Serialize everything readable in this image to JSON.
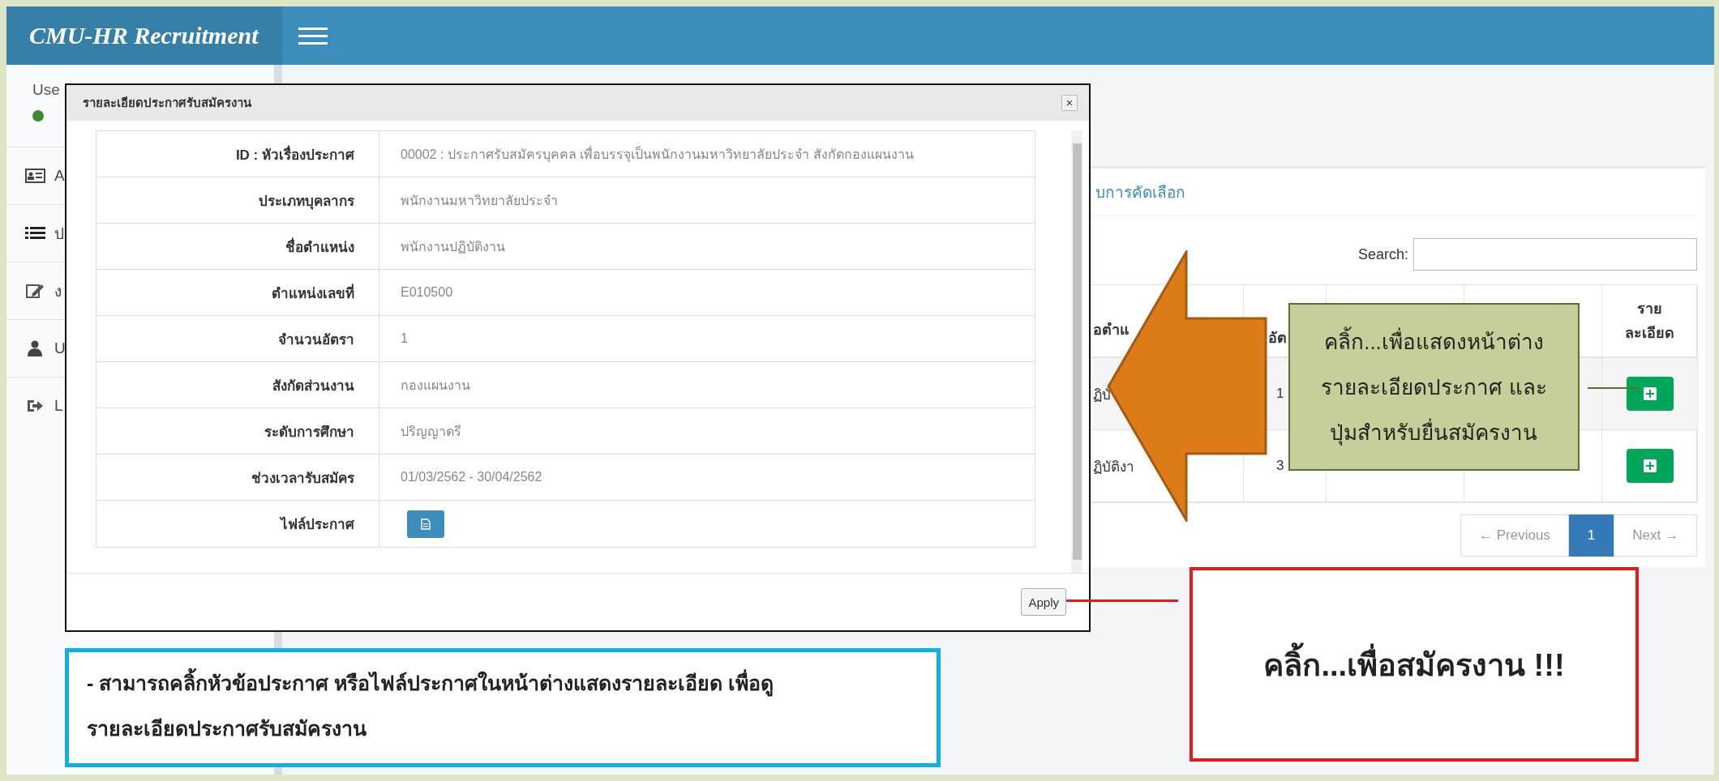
{
  "app": {
    "title": "CMU-HR Recruitment"
  },
  "sidebar": {
    "user_label": "Use",
    "items": [
      {
        "label": "A"
      },
      {
        "label": "ป"
      },
      {
        "label": "ง"
      },
      {
        "label": "U"
      },
      {
        "label": "L"
      }
    ]
  },
  "panel": {
    "heading": "บการคัดเลือก",
    "search_label": "Search:",
    "table": {
      "columns": [
        {
          "label": "อตำแ"
        },
        {
          "label": "อัต"
        },
        {},
        {},
        {
          "label": "ราย\nละเอียด"
        }
      ],
      "rows": [
        {
          "cells": [
            "ฏิบั",
            "1"
          ]
        },
        {
          "cells": [
            "ฏิบัติงา",
            "3"
          ]
        }
      ]
    },
    "pagination": {
      "previous": "← Previous",
      "pages": [
        {
          "label": "1",
          "selected": true
        }
      ],
      "next": "Next →"
    }
  },
  "modal": {
    "title": "รายละเอียดประกาศรับสมัครงาน",
    "close": "×",
    "rows": [
      {
        "kind": "text",
        "label": "ID : หัวเรื่องประกาศ",
        "value": "00002 : ประกาศรับสมัครบุคคล เพื่อบรรจุเป็นพนักงานมหาวิทยาลัยประจำ สังกัดกองแผนงาน"
      },
      {
        "kind": "text",
        "label": "ประเภทบุคลากร",
        "value": "พนักงานมหาวิทยาลัยประจำ"
      },
      {
        "kind": "text",
        "label": "ชื่อตำแหน่ง",
        "value": "พนักงานปฏิบัติงาน"
      },
      {
        "kind": "text",
        "label": "ตำแหน่งเลขที่",
        "value": "E010500"
      },
      {
        "kind": "text",
        "label": "จำนวนอัตรา",
        "value": "1"
      },
      {
        "kind": "text",
        "label": "สังกัดส่วนงาน",
        "value": "กองแผนงาน"
      },
      {
        "kind": "text",
        "label": "ระดับการศึกษา",
        "value": "ปริญญาตรี"
      },
      {
        "kind": "text",
        "label": "ช่วงเวลารับสมัคร",
        "value": "01/03/2562 - 30/04/2562"
      },
      {
        "kind": "file",
        "label": "ไฟล์ประกาศ"
      }
    ],
    "apply_button": "Apply"
  },
  "annotations": {
    "callout": "คลิ้ก...เพื่อแสดงหน้าต่าง\nรายละเอียดประกาศ และ\nปุ่มสำหรับยื่นสมัครงาน",
    "apply_note": "คลิ้ก...เพื่อสมัครงาน !!!",
    "info_note": "- สามารถคลิ้กหัวข้อประกาศ หรือไฟล์ประกาศในหน้าต่างแสดงรายละเอียด เพื่อดู\nรายละเอียดประกาศรับสมัครงาน"
  }
}
